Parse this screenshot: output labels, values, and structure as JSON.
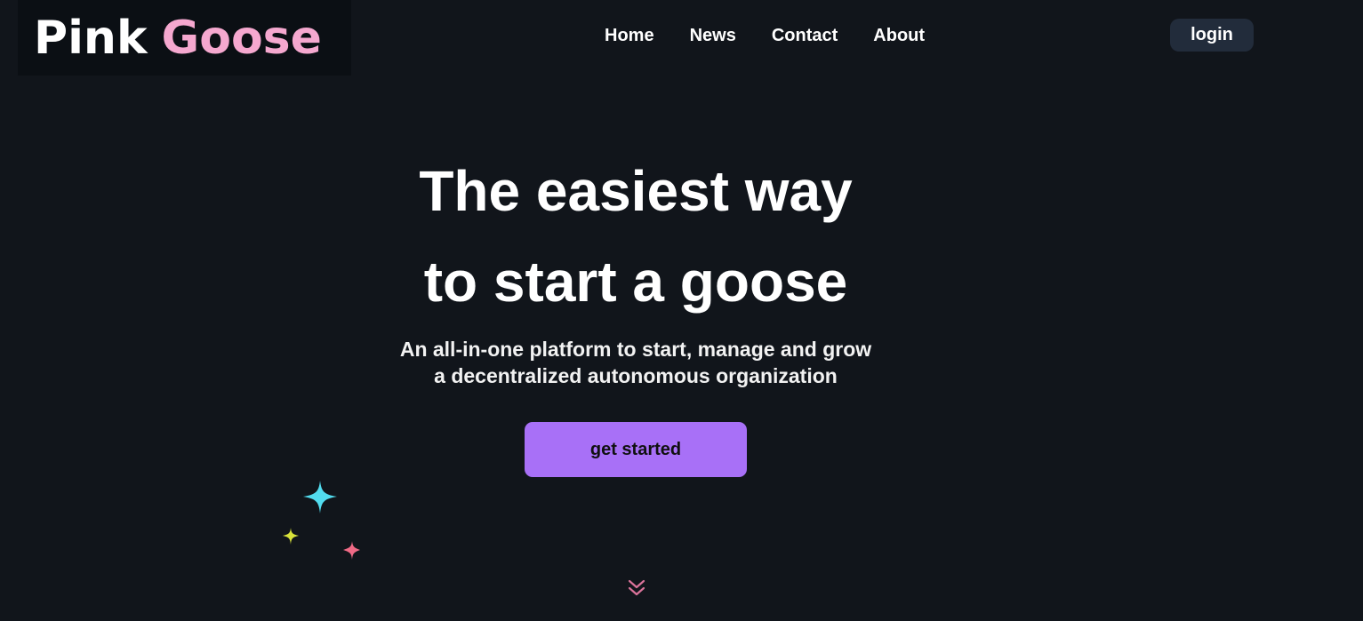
{
  "brand": {
    "word1": "Pink",
    "word2": "Goose",
    "colors": {
      "word1": "#ffffff",
      "word2": "#f5a8cf"
    }
  },
  "nav": {
    "items": [
      {
        "label": "Home"
      },
      {
        "label": "News"
      },
      {
        "label": "Contact"
      },
      {
        "label": "About"
      }
    ]
  },
  "header": {
    "login_label": "login"
  },
  "hero": {
    "title_line1": "The easiest way",
    "title_line2": "to start a goose",
    "subtitle_line1": "An all-in-one platform to start, manage and grow",
    "subtitle_line2": "a decentralized autonomous organization",
    "cta_label": "get started"
  },
  "colors": {
    "background": "#11151b",
    "accent": "#a870f7",
    "login_bg": "#222c3b",
    "sparkle_cyan": "#52dcef",
    "sparkle_yellow": "#d8e23a",
    "sparkle_pink": "#f06a86"
  },
  "icons": [
    "sparkles-icon",
    "double-chevron-down-icon"
  ]
}
